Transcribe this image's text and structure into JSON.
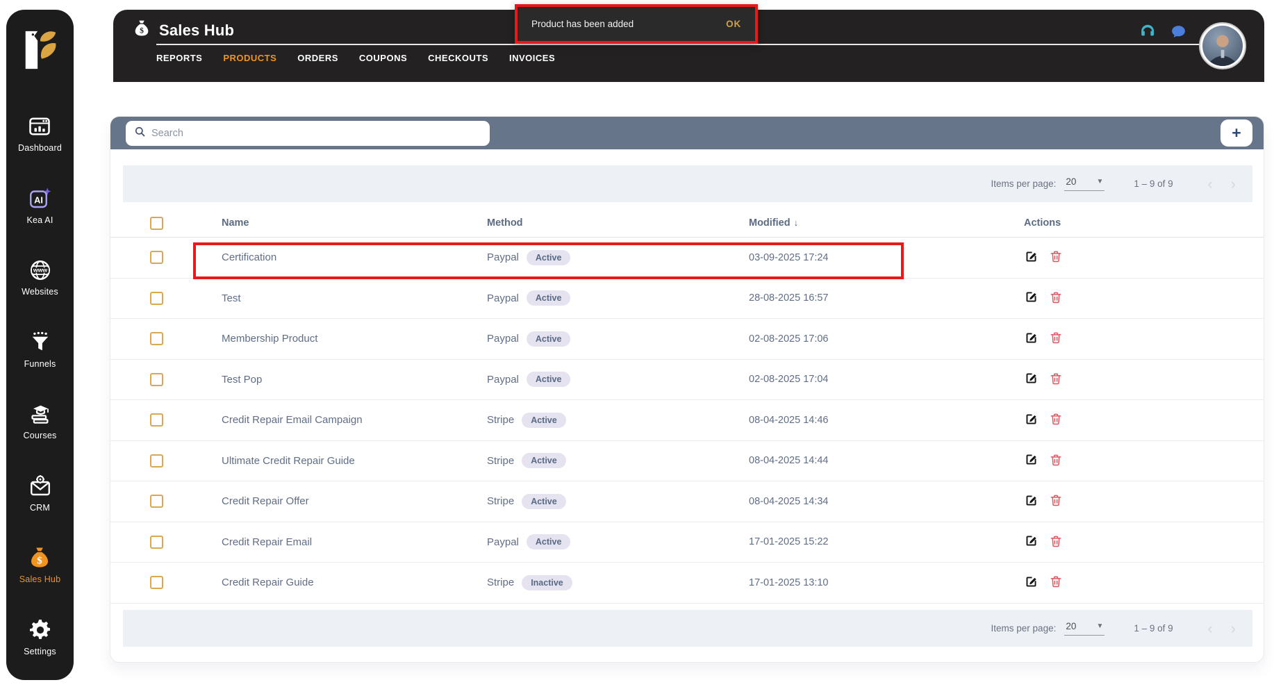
{
  "sidebar": {
    "items": [
      {
        "label": "Dashboard",
        "active": false
      },
      {
        "label": "Kea AI",
        "active": false
      },
      {
        "label": "Websites",
        "active": false
      },
      {
        "label": "Funnels",
        "active": false
      },
      {
        "label": "Courses",
        "active": false
      },
      {
        "label": "CRM",
        "active": false
      },
      {
        "label": "Sales Hub",
        "active": true
      },
      {
        "label": "Settings",
        "active": false
      }
    ]
  },
  "header": {
    "title": "Sales Hub",
    "tabs": [
      {
        "label": "REPORTS",
        "active": false
      },
      {
        "label": "PRODUCTS",
        "active": true
      },
      {
        "label": "ORDERS",
        "active": false
      },
      {
        "label": "COUPONS",
        "active": false
      },
      {
        "label": "CHECKOUTS",
        "active": false
      },
      {
        "label": "INVOICES",
        "active": false
      }
    ]
  },
  "toast": {
    "message": "Product has been added",
    "action_label": "OK"
  },
  "toolbar": {
    "search_placeholder": "Search",
    "add_button_label": "+"
  },
  "paginator": {
    "items_per_page_label": "Items per page:",
    "items_per_page_value": "20",
    "range_label": "1 – 9 of 9",
    "prev_icon": "‹",
    "next_icon": "›"
  },
  "table": {
    "columns": {
      "name": "Name",
      "method": "Method",
      "modified": "Modified",
      "actions": "Actions"
    },
    "sort_indicator": "↓",
    "rows": [
      {
        "name": "Certification",
        "method": "Paypal",
        "status": "Active",
        "modified": "03-09-2025 17:24",
        "highlighted": true
      },
      {
        "name": "Test",
        "method": "Paypal",
        "status": "Active",
        "modified": "28-08-2025 16:57",
        "highlighted": false
      },
      {
        "name": "Membership Product",
        "method": "Paypal",
        "status": "Active",
        "modified": "02-08-2025 17:06",
        "highlighted": false
      },
      {
        "name": "Test Pop",
        "method": "Paypal",
        "status": "Active",
        "modified": "02-08-2025 17:04",
        "highlighted": false
      },
      {
        "name": "Credit Repair Email Campaign",
        "method": "Stripe",
        "status": "Active",
        "modified": "08-04-2025 14:46",
        "highlighted": false
      },
      {
        "name": "Ultimate Credit Repair Guide",
        "method": "Stripe",
        "status": "Active",
        "modified": "08-04-2025 14:44",
        "highlighted": false
      },
      {
        "name": "Credit Repair Offer",
        "method": "Stripe",
        "status": "Active",
        "modified": "08-04-2025 14:34",
        "highlighted": false
      },
      {
        "name": "Credit Repair Email",
        "method": "Paypal",
        "status": "Active",
        "modified": "17-01-2025 15:22",
        "highlighted": false
      },
      {
        "name": "Credit Repair Guide",
        "method": "Stripe",
        "status": "Inactive",
        "modified": "17-01-2025 13:10",
        "highlighted": false
      }
    ]
  },
  "colors": {
    "accent_orange": "#F0941F",
    "dark_surface": "#232121",
    "sidebar_surface": "#1D1C1C",
    "slate_bar": "#66758A",
    "table_text": "#5F6E86",
    "badge_bg": "#E4E3EF",
    "annotation_red": "#E61A1A",
    "toast_action_gold": "#CDA14A",
    "delete_red": "#E25560",
    "headset_teal": "#3EB5C9",
    "chat_blue": "#4B7FDB"
  }
}
